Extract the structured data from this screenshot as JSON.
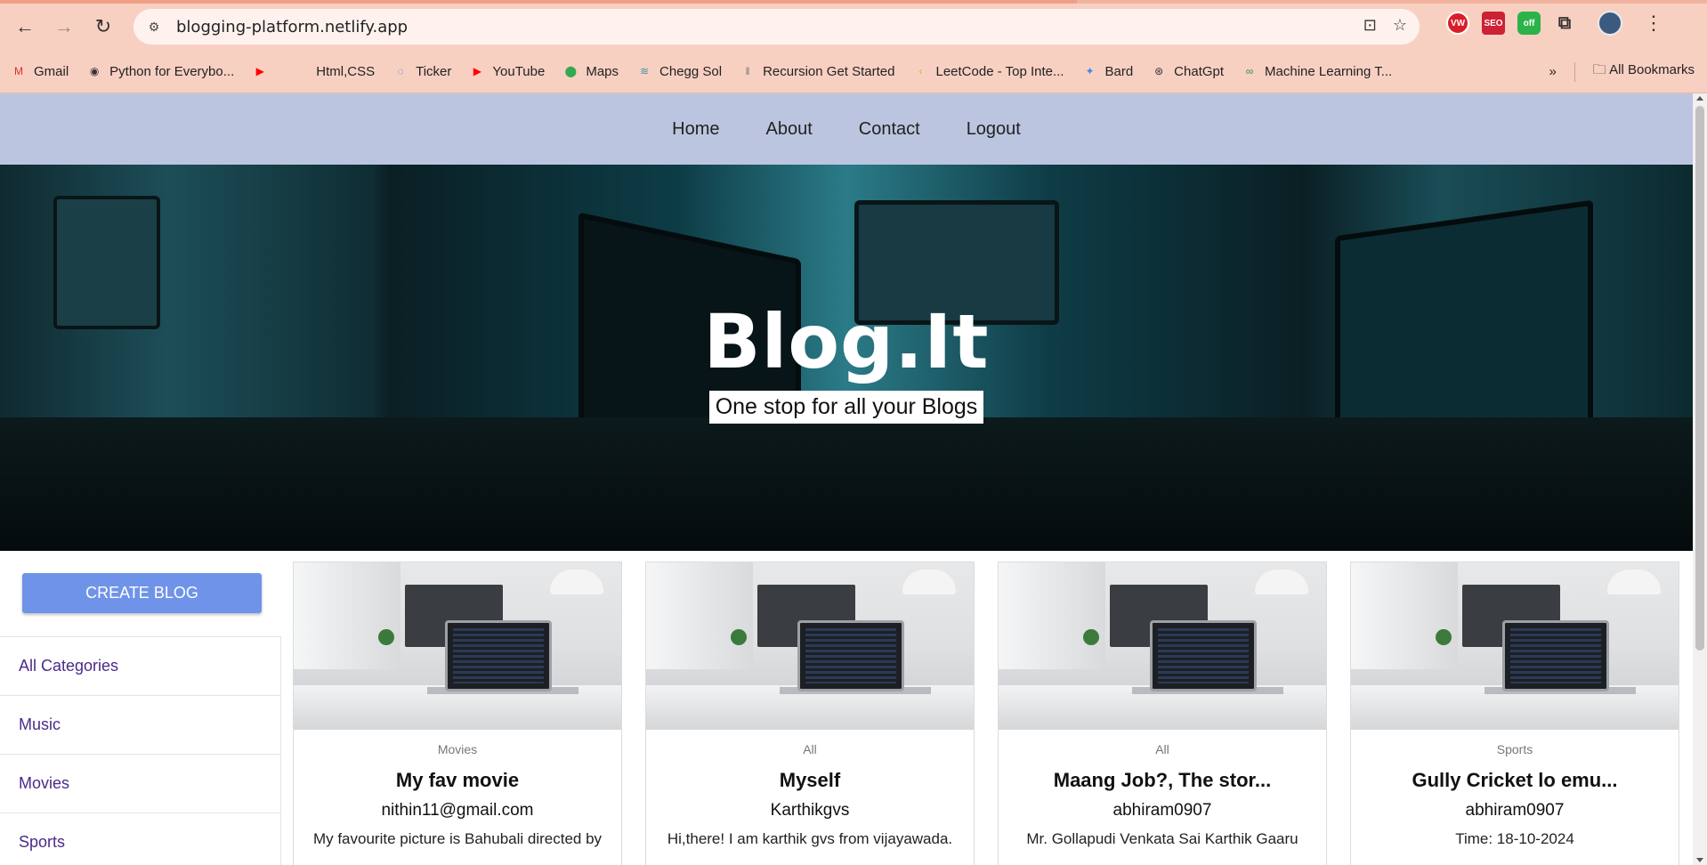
{
  "browser": {
    "url": "blogging-platform.netlify.app",
    "bookmarks": [
      {
        "label": "Gmail",
        "icon": "gmail-icon",
        "color": "#d93025"
      },
      {
        "label": "Python for Everybo...",
        "icon": "globe-icon",
        "color": "#333333"
      },
      {
        "label": "",
        "icon": "youtube-icon",
        "color": "#ff0000"
      },
      {
        "label": "Html,CSS",
        "icon": "blank-icon",
        "color": "#f8d0c2"
      },
      {
        "label": "Ticker",
        "icon": "ticker-icon",
        "color": "#1a73e8"
      },
      {
        "label": "YouTube",
        "icon": "youtube-icon",
        "color": "#ff0000"
      },
      {
        "label": "Maps",
        "icon": "maps-icon",
        "color": "#34a853"
      },
      {
        "label": "Chegg Sol",
        "icon": "stack-icon",
        "color": "#4a90a4"
      },
      {
        "label": "Recursion Get Started",
        "icon": "recursion-icon",
        "color": "#777777"
      },
      {
        "label": "LeetCode - Top Inte...",
        "icon": "leetcode-icon",
        "color": "#f89f1b"
      },
      {
        "label": "Bard",
        "icon": "sparkle-icon",
        "color": "#4285f4"
      },
      {
        "label": "ChatGpt",
        "icon": "chatgpt-icon",
        "color": "#333333"
      },
      {
        "label": "Machine Learning T...",
        "icon": "gfg-icon",
        "color": "#2f8d46"
      }
    ],
    "all_bookmarks": "All Bookmarks",
    "extensions": {
      "vw": "VW",
      "seo": "SEO",
      "off": "off"
    }
  },
  "nav": {
    "items": [
      "Home",
      "About",
      "Contact",
      "Logout"
    ]
  },
  "hero": {
    "title": "Blog.It",
    "subtitle": "One stop for all your Blogs"
  },
  "sidebar": {
    "create_label": "CREATE BLOG",
    "categories": [
      "All Categories",
      "Music",
      "Movies",
      "Sports"
    ]
  },
  "cards": [
    {
      "category": "Movies",
      "title": "My fav movie",
      "author": "nithin11@gmail.com",
      "desc": "My favourite picture is Bahubali directed by"
    },
    {
      "category": "All",
      "title": "Myself",
      "author": "Karthikgvs",
      "desc": "Hi,there! I am karthik gvs from vijayawada."
    },
    {
      "category": "All",
      "title": "Maang Job?, The stor...",
      "author": "abhiram0907",
      "desc": "Mr. Gollapudi Venkata Sai Karthik Gaaru"
    },
    {
      "category": "Sports",
      "title": "Gully Cricket lo emu...",
      "author": "abhiram0907",
      "desc": "Time: 18-10-2024"
    }
  ],
  "colors": {
    "nav_bg": "#bcc5e0",
    "create_btn": "#6f93e8",
    "category_link": "#4b2a8a"
  }
}
